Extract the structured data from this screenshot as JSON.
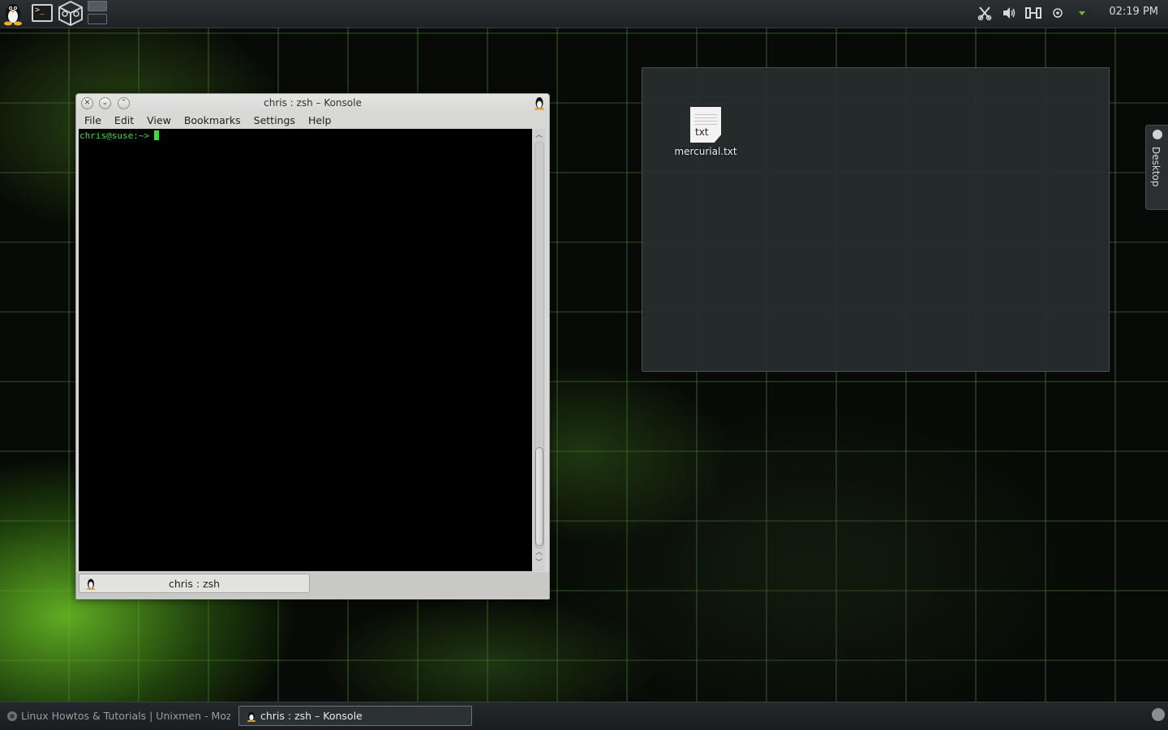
{
  "top_panel": {
    "clock": "02:19 PM",
    "tray_icons": [
      "klipper-icon",
      "volume-icon",
      "battery-icon",
      "network-icon",
      "expand-arrow-icon"
    ]
  },
  "desktop": {
    "folder_view": {
      "files": [
        {
          "name": "mercurial.txt",
          "icon_ext": "txt"
        }
      ]
    },
    "side_tab_label": "Desktop"
  },
  "konsole": {
    "title": "chris : zsh – Konsole",
    "menu": [
      "File",
      "Edit",
      "View",
      "Bookmarks",
      "Settings",
      "Help"
    ],
    "prompt": "chris@suse:~>",
    "session_tab": "chris : zsh",
    "colors": {
      "prompt_green": "#3bdb3b",
      "terminal_bg": "#000000"
    }
  },
  "taskbar": {
    "tasks": [
      {
        "label": "Linux Howtos & Tutorials | Unixmen - Mozilla Firefox",
        "active": false
      },
      {
        "label": "chris : zsh – Konsole",
        "active": true
      }
    ]
  }
}
